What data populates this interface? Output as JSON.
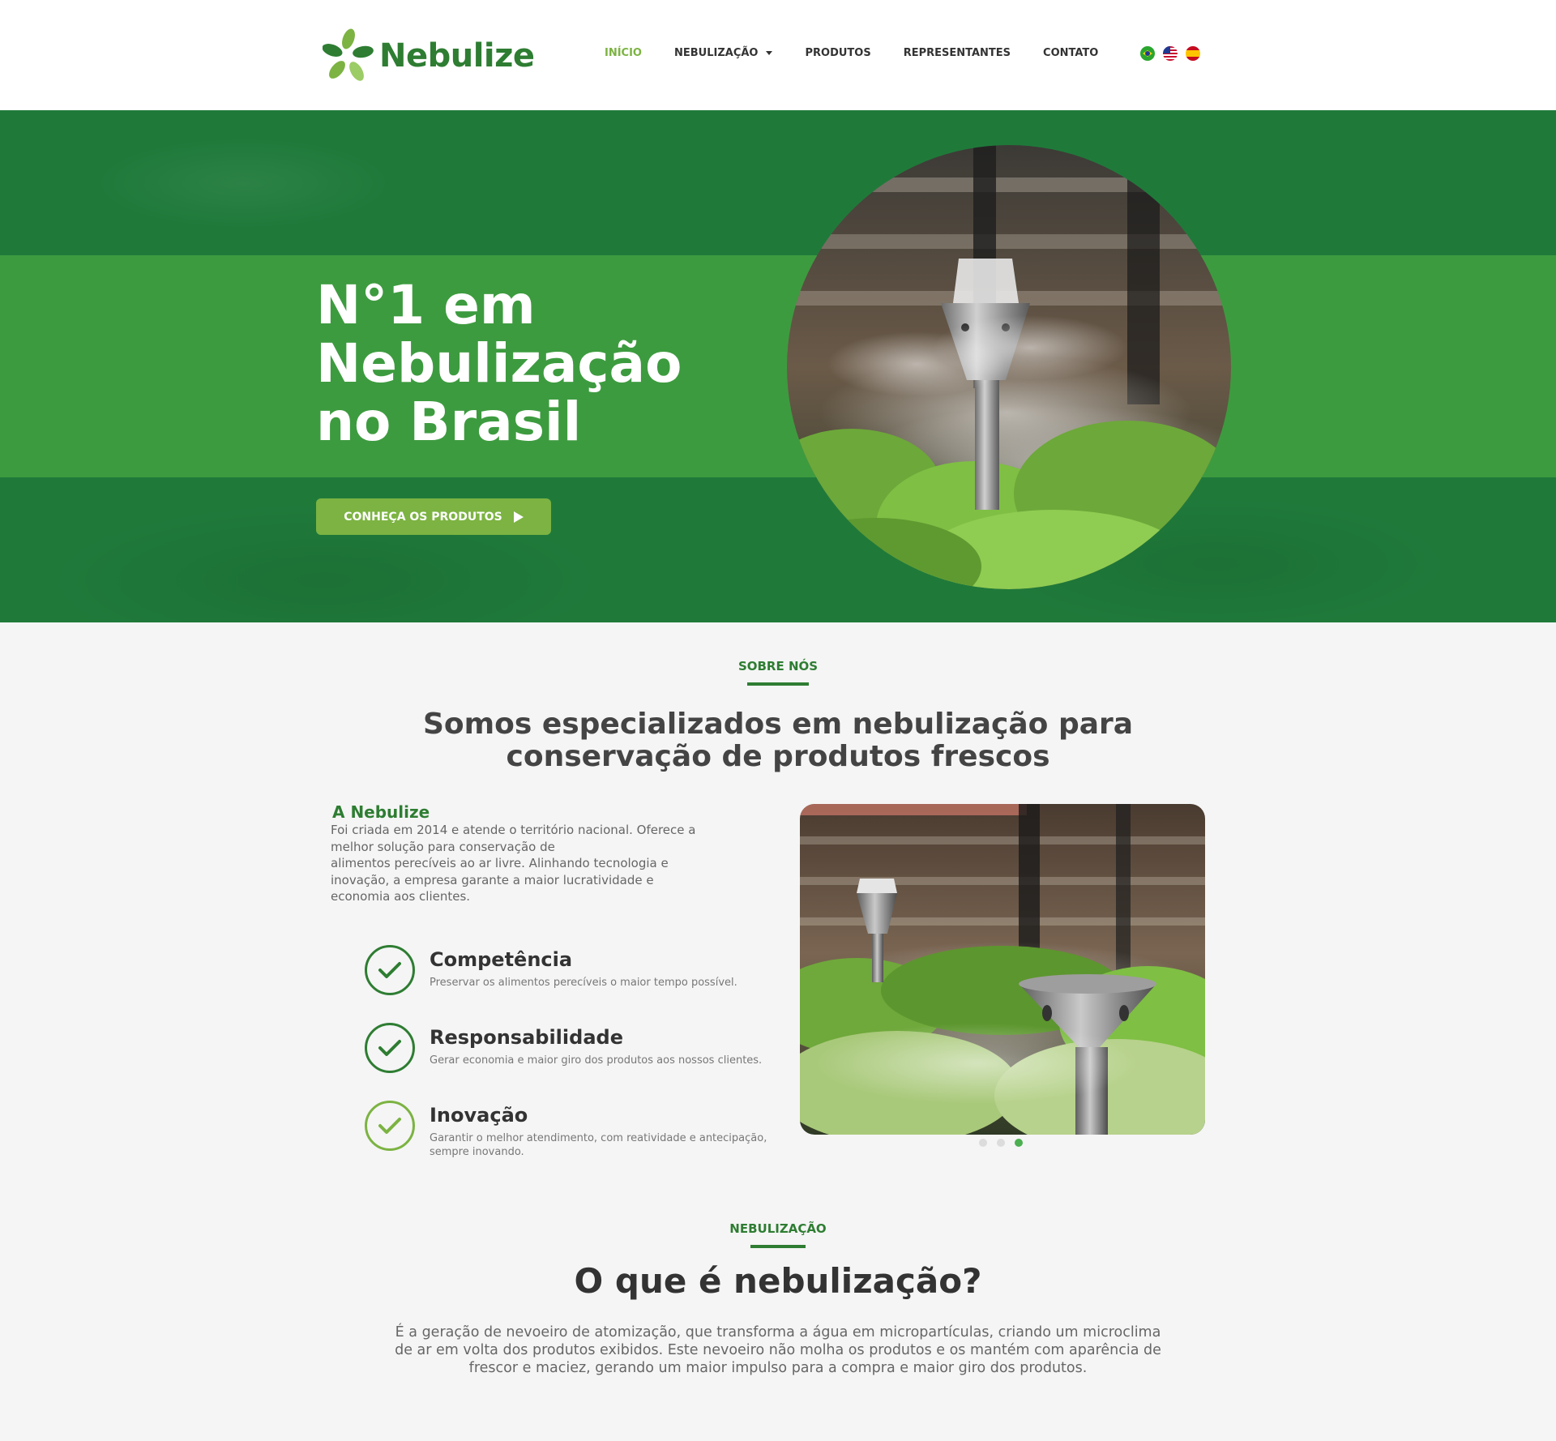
{
  "brand": {
    "name": "Nebulize",
    "primary_color": "#2e7d32",
    "accent_color": "#7cb342",
    "hero_band_color": "#3d9b3f"
  },
  "nav": {
    "items": [
      {
        "label": "INÍCIO",
        "active": true
      },
      {
        "label": "NEBULIZAÇÃO",
        "active": false,
        "has_dropdown": true
      },
      {
        "label": "PRODUTOS",
        "active": false
      },
      {
        "label": "REPRESENTANTES",
        "active": false
      },
      {
        "label": "CONTATO",
        "active": false
      }
    ],
    "languages": [
      "pt-BR",
      "en-US",
      "es-ES"
    ]
  },
  "hero": {
    "title_lines": [
      "N°1 em",
      "Nebulização",
      "no Brasil"
    ],
    "button_label": "CONHEÇA OS PRODUTOS"
  },
  "about": {
    "kicker": "SOBRE NÓS",
    "title_lines": [
      "Somos especializados em nebulização para",
      "conservação de produtos frescos"
    ],
    "company_name": "A Nebulize",
    "description_lines": [
      "Foi criada em 2014 e atende o território nacional. Oferece a",
      "melhor solução para conservação de",
      "alimentos perecíveis ao ar livre. Alinhando tecnologia e",
      "inovação, a empresa garante a maior lucratividade e",
      "economia aos clientes."
    ],
    "features": [
      {
        "title": "Competência",
        "description": "Preservar os alimentos perecíveis o maior tempo possível.",
        "icon": "check-circle-icon",
        "color": "#2e7d32"
      },
      {
        "title": "Responsabilidade",
        "description": "Gerar economia e maior giro dos produtos aos nossos clientes.",
        "icon": "check-circle-icon",
        "color": "#2e7d32"
      },
      {
        "title": "Inovação",
        "description": "Garantir o melhor atendimento, com reatividade e antecipação, sempre inovando.",
        "icon": "check-circle-icon",
        "color": "#7cb342"
      }
    ],
    "carousel": {
      "slides": 3,
      "active_index": 2
    }
  },
  "nebulizacao": {
    "kicker": "NEBULIZAÇÃO",
    "title": "O que é nebulização?",
    "description_lines": [
      "É a geração de nevoeiro de atomização, que transforma a água em micropartículas, criando um microclima",
      "de ar em volta dos produtos exibidos. Este nevoeiro não molha os produtos e os mantém com aparência de",
      "frescor e maciez, gerando um maior impulso para a compra e maior giro dos produtos."
    ]
  }
}
